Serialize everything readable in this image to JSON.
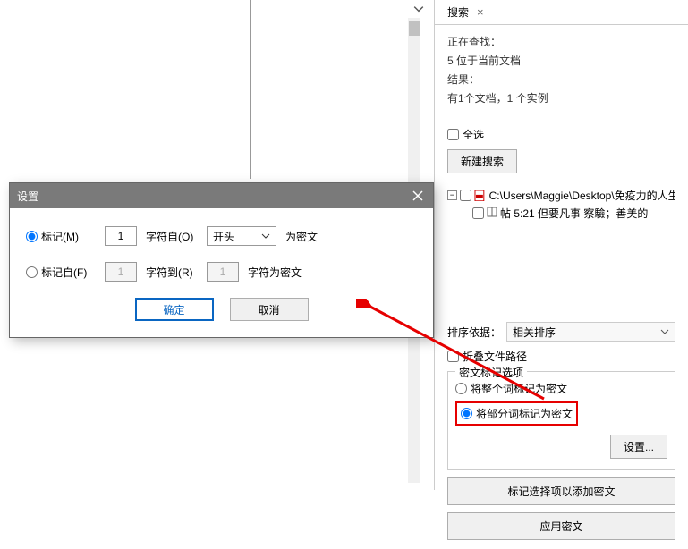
{
  "panel": {
    "tab_label": "搜索",
    "searching": "正在查找：",
    "position": "5 位于当前文档",
    "results_label": "结果：",
    "results_text": "有1个文档，1 个实例",
    "select_all": "全选",
    "new_search": "新建搜索",
    "tree": {
      "file_path": "C:\\Users\\Maggie\\Desktop\\免疫力的人生",
      "hit": "帖 5:21 但要凡事 察驗；善美的"
    },
    "sort_label": "排序依据：",
    "sort_value": "相关排序",
    "collapse_paths": "折叠文件路径",
    "group_title": "密文标记选项",
    "radio_whole": "将整个词标记为密文",
    "radio_partial": "将部分词标记为密文",
    "settings_btn": "设置...",
    "add_redact": "标记选择项以添加密文",
    "apply_redact": "应用密文"
  },
  "dialog": {
    "title": "设置",
    "mark_m": "标记(M)",
    "mark_from_f": "标记自(F)",
    "chars_from_o": "字符自(O)",
    "chars_to_r": "字符到(R)",
    "combo_value": "开头",
    "suffix1": "为密文",
    "suffix2": "字符为密文",
    "val1": "1",
    "val2": "1",
    "val3": "1",
    "ok": "确定",
    "cancel": "取消"
  }
}
